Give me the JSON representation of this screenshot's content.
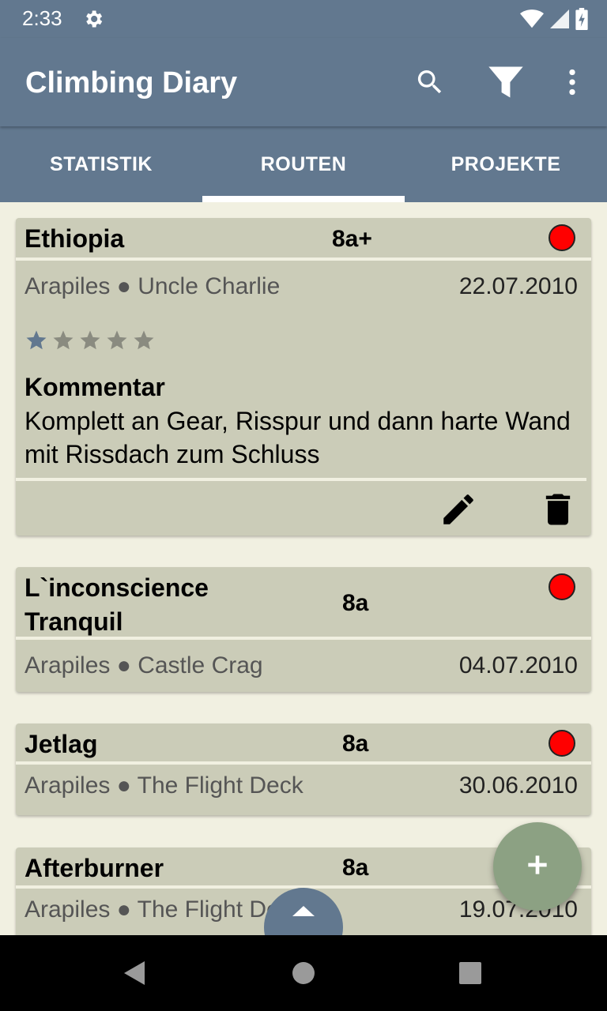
{
  "status_bar": {
    "time": "2:33",
    "icons": [
      "settings-gear-icon",
      "wifi-icon",
      "cell-signal-icon",
      "battery-icon"
    ]
  },
  "app_bar": {
    "title": "Climbing Diary",
    "actions": [
      "search-icon",
      "filter-icon",
      "more-vert-icon"
    ]
  },
  "tabs": [
    {
      "label": "STATISTIK",
      "active": false
    },
    {
      "label": "ROUTEN",
      "active": true
    },
    {
      "label": "PROJEKTE",
      "active": false
    }
  ],
  "routes": [
    {
      "name": "Ethiopia",
      "grade": "8a+",
      "area": "Arapiles",
      "sector": "Uncle Charlie",
      "separator": "●",
      "date": "22.07.2010",
      "rating": 1,
      "rating_max": 5,
      "comment_heading": "Kommentar",
      "comment": "Komplett an Gear, Risspur und dann harte Wand mit Rissdach zum Schluss",
      "style_color": "#ff0000",
      "expanded": true
    },
    {
      "name": "L`inconscience Tranquil",
      "grade": "8a",
      "area": "Arapiles",
      "sector": "Castle Crag",
      "separator": "●",
      "date": "04.07.2010",
      "style_color": "#ff0000"
    },
    {
      "name": "Jetlag",
      "grade": "8a",
      "area": "Arapiles",
      "sector": "The Flight Deck",
      "separator": "●",
      "date": "30.06.2010",
      "style_color": "#ff0000"
    },
    {
      "name": "Afterburner",
      "grade": "8a",
      "area": "Arapiles",
      "sector": "The Flight Deck",
      "separator": "●",
      "date": "19.07.2010",
      "style_color": "#ff0000"
    }
  ],
  "colors": {
    "primary": "#62788f",
    "background": "#f1f0e1",
    "card": "#cbccb8",
    "fab": "#8ca183",
    "star_active": "#62788f",
    "star_inactive": "#8a8b80"
  },
  "fab": {
    "icon": "plus-icon"
  },
  "scroll_button": {
    "icon": "chevron-up-icon"
  },
  "nav": [
    "back-icon",
    "home-icon",
    "recents-icon"
  ]
}
